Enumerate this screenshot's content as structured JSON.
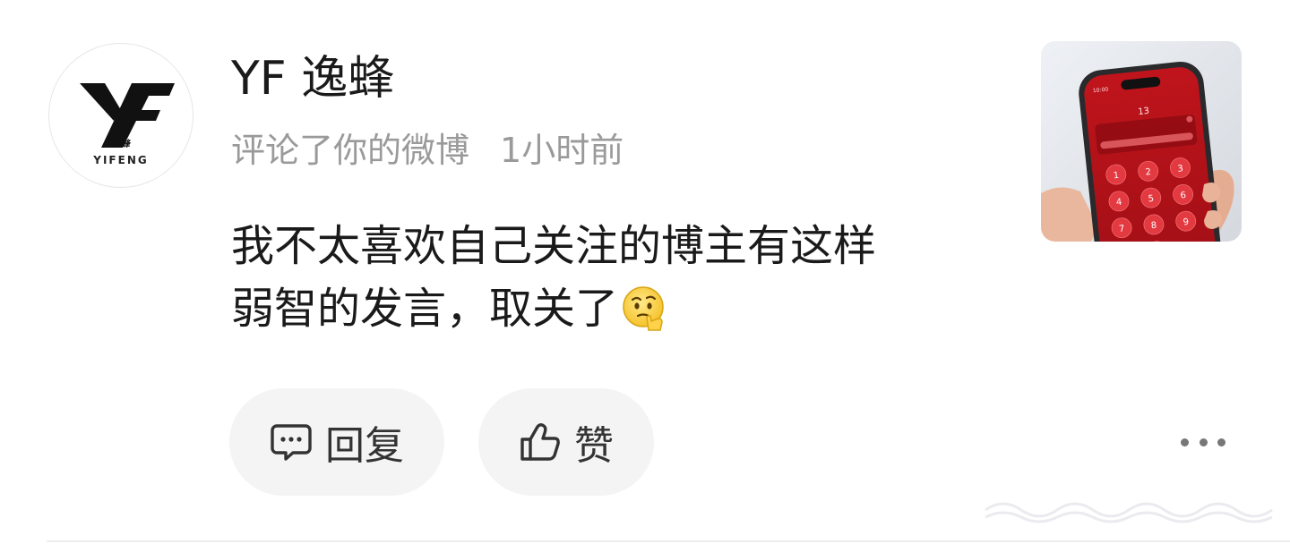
{
  "post": {
    "author": "YF 逸蜂",
    "action_text": "评论了你的微博",
    "time": "1小时前",
    "comment_lines": [
      "我不太喜欢自己关注的博主有这样",
      "弱智的发言，取关了"
    ],
    "emoji_icon": "thinking-face-emoji",
    "avatar": {
      "logo_letters": "YF",
      "logo_small_text": "逸蜂",
      "caption": "YIFENG"
    },
    "thumbnail": {
      "icon": "phone-photo",
      "screen_time": "10:00",
      "attempt_count": "13",
      "keypad": [
        [
          "1",
          "2",
          "3"
        ],
        [
          "4",
          "5",
          "6"
        ],
        [
          "7",
          "8",
          "9"
        ]
      ]
    }
  },
  "actions": {
    "reply_label": "回复",
    "reply_icon": "comment-bubble-icon",
    "like_label": "赞",
    "like_icon": "thumbs-up-icon",
    "more_icon": "more-dots-icon"
  },
  "colors": {
    "text_primary": "#1a1a1a",
    "text_secondary": "#9a9a9a",
    "pill_bg": "#f4f4f4",
    "phone_red": "#b8141b"
  }
}
